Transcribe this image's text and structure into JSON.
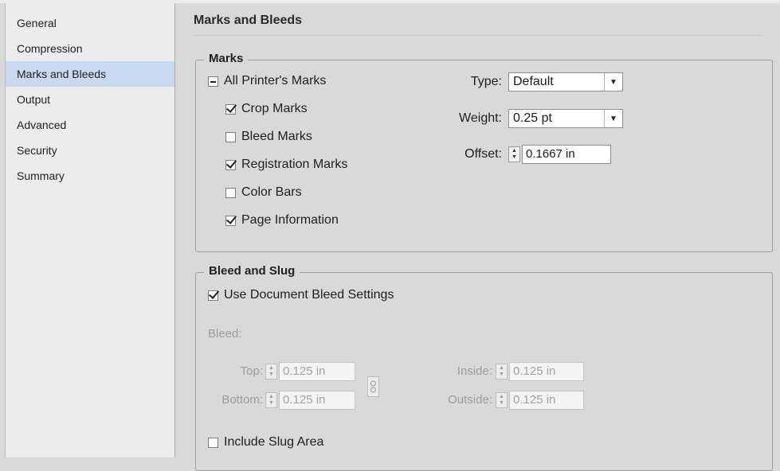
{
  "sidebar": {
    "items": [
      {
        "label": "General"
      },
      {
        "label": "Compression"
      },
      {
        "label": "Marks and Bleeds"
      },
      {
        "label": "Output"
      },
      {
        "label": "Advanced"
      },
      {
        "label": "Security"
      },
      {
        "label": "Summary"
      }
    ],
    "selected": "Marks and Bleeds"
  },
  "main": {
    "title": "Marks and Bleeds",
    "marks": {
      "legend": "Marks",
      "all_printers_marks": {
        "label": "All Printer's Marks",
        "state": "mixed"
      },
      "crop_marks": {
        "label": "Crop Marks",
        "checked": true
      },
      "bleed_marks": {
        "label": "Bleed Marks",
        "checked": false
      },
      "registration_marks": {
        "label": "Registration Marks",
        "checked": true
      },
      "color_bars": {
        "label": "Color Bars",
        "checked": false
      },
      "page_information": {
        "label": "Page Information",
        "checked": true
      },
      "type": {
        "label": "Type:",
        "value": "Default"
      },
      "weight": {
        "label": "Weight:",
        "value": "0.25 pt"
      },
      "offset": {
        "label": "Offset:",
        "value": "0.1667 in"
      }
    },
    "bleed_slug": {
      "legend": "Bleed and Slug",
      "use_document_bleed": {
        "label": "Use Document Bleed Settings",
        "checked": true
      },
      "bleed_label": "Bleed:",
      "top": {
        "label": "Top:",
        "value": "0.125 in"
      },
      "bottom": {
        "label": "Bottom:",
        "value": "0.125 in"
      },
      "inside": {
        "label": "Inside:",
        "value": "0.125 in"
      },
      "outside": {
        "label": "Outside:",
        "value": "0.125 in"
      },
      "include_slug": {
        "label": "Include Slug Area",
        "checked": false
      }
    }
  },
  "icons": {
    "dropdown_arrow": "▼",
    "spin_up": "▲",
    "spin_down": "▼",
    "link": "chain-link-icon"
  }
}
